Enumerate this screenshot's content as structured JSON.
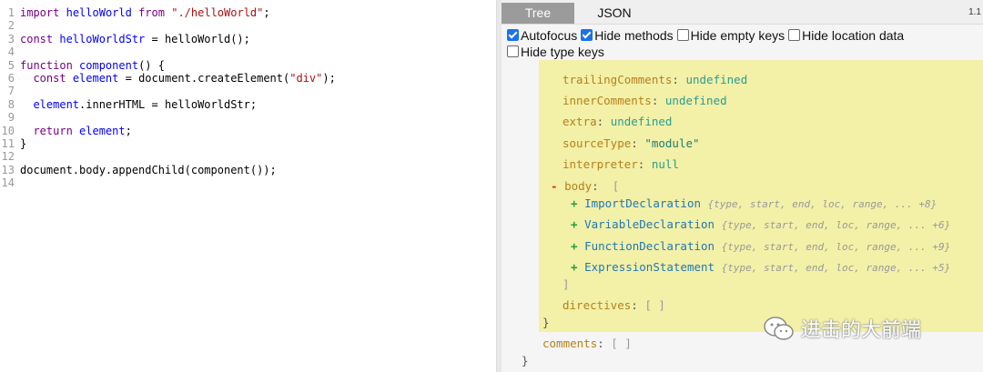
{
  "editor": {
    "lines": [
      {
        "num": "1",
        "html_parts": [
          [
            "kw",
            "import"
          ],
          [
            "code",
            " "
          ],
          [
            "def",
            "helloWorld"
          ],
          [
            "code",
            " "
          ],
          [
            "kw",
            "from"
          ],
          [
            "code",
            " "
          ],
          [
            "str",
            "\"./helloWorld\""
          ],
          [
            "code",
            ";"
          ]
        ]
      },
      {
        "num": "2",
        "html_parts": []
      },
      {
        "num": "3",
        "html_parts": [
          [
            "kw",
            "const"
          ],
          [
            "code",
            " "
          ],
          [
            "def",
            "helloWorldStr"
          ],
          [
            "code",
            " = helloWorld();"
          ]
        ]
      },
      {
        "num": "4",
        "html_parts": []
      },
      {
        "num": "5",
        "html_parts": [
          [
            "kw",
            "function"
          ],
          [
            "code",
            " "
          ],
          [
            "def",
            "component"
          ],
          [
            "code",
            "() {"
          ]
        ]
      },
      {
        "num": "6",
        "html_parts": [
          [
            "code",
            "  "
          ],
          [
            "kw",
            "const"
          ],
          [
            "code",
            " "
          ],
          [
            "def",
            "element"
          ],
          [
            "code",
            " = document.createElement("
          ],
          [
            "str",
            "\"div\""
          ],
          [
            "code",
            ");"
          ]
        ]
      },
      {
        "num": "7",
        "html_parts": []
      },
      {
        "num": "8",
        "html_parts": [
          [
            "code",
            "  "
          ],
          [
            "def",
            "element"
          ],
          [
            "code",
            ".innerHTML = helloWorldStr;"
          ]
        ]
      },
      {
        "num": "9",
        "html_parts": []
      },
      {
        "num": "10",
        "html_parts": [
          [
            "code",
            "  "
          ],
          [
            "kw",
            "return"
          ],
          [
            "code",
            " "
          ],
          [
            "def",
            "element"
          ],
          [
            "code",
            ";"
          ]
        ]
      },
      {
        "num": "11",
        "html_parts": [
          [
            "code",
            "}"
          ]
        ]
      },
      {
        "num": "12",
        "html_parts": []
      },
      {
        "num": "13",
        "html_parts": [
          [
            "code",
            "document.body.appendChild(component());"
          ]
        ]
      },
      {
        "num": "14",
        "html_parts": []
      }
    ]
  },
  "tabs": {
    "tree": "Tree",
    "json": "JSON",
    "version": "1.1"
  },
  "options": [
    {
      "label": "Autofocus",
      "checked": true
    },
    {
      "label": "Hide methods",
      "checked": true
    },
    {
      "label": "Hide empty keys",
      "checked": false
    },
    {
      "label": "Hide location data",
      "checked": false
    },
    {
      "label": "Hide type keys",
      "checked": false
    }
  ],
  "tree": {
    "props": [
      {
        "key": "trailingComments",
        "value": "undefined",
        "kind": "undef"
      },
      {
        "key": "innerComments",
        "value": "undefined",
        "kind": "undef"
      },
      {
        "key": "extra",
        "value": "undefined",
        "kind": "undef"
      },
      {
        "key": "sourceType",
        "value": "\"module\"",
        "kind": "str"
      },
      {
        "key": "interpreter",
        "value": "null",
        "kind": "null"
      }
    ],
    "body_toggle": "-",
    "body_key": "body",
    "body_open": "[",
    "body_close": "]",
    "body_items": [
      {
        "toggle": "+",
        "type": "ImportDeclaration",
        "summary": "{type, start, end, loc, range, ... +8}"
      },
      {
        "toggle": "+",
        "type": "VariableDeclaration",
        "summary": "{type, start, end, loc, range, ... +6}"
      },
      {
        "toggle": "+",
        "type": "FunctionDeclaration",
        "summary": "{type, start, end, loc, range, ... +9}"
      },
      {
        "toggle": "+",
        "type": "ExpressionStatement",
        "summary": "{type, start, end, loc, range, ... +5}"
      }
    ],
    "directives_key": "directives",
    "directives_value": "[ ]",
    "inner_close": "}",
    "comments_key": "comments",
    "comments_value": "[ ]",
    "outer_close": "}"
  },
  "watermark": {
    "text": "进击的大前端",
    "icon": "wechat-icon"
  }
}
